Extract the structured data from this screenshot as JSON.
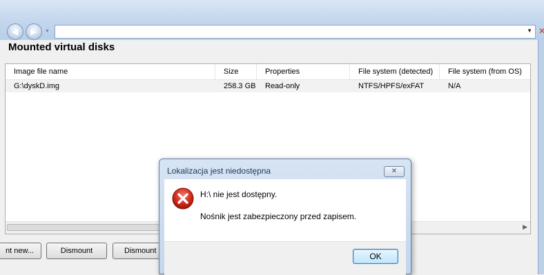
{
  "colors": {
    "accent": "#3c7fb1",
    "error": "#c0392b",
    "row_bg": "#f2f2f2"
  },
  "icons": {
    "back": "back-arrow-icon",
    "forward": "forward-arrow-icon",
    "error": "error-icon",
    "close": "close-icon",
    "dropdown": "chevron-down-icon"
  },
  "browser": {
    "address_value": ""
  },
  "app": {
    "heading": "Mounted virtual disks",
    "columns": [
      "Image file name",
      "Size",
      "Properties",
      "File system (detected)",
      "File system (from OS)"
    ],
    "rows": [
      {
        "image": "G:\\dyskD.img",
        "size": "258.3 GB",
        "properties": "Read-only",
        "fs_detected": "NTFS/HPFS/exFAT",
        "fs_os": "N/A"
      }
    ],
    "buttons": {
      "mount_new": "nt new...",
      "dismount": "Dismount",
      "dismount_all": "Dismount a"
    }
  },
  "dialog": {
    "title": "Lokalizacja jest niedostępna",
    "message_main": "H:\\ nie jest dostępny.",
    "message_detail": "Nośnik jest zabezpieczony przed zapisem.",
    "ok_label": "OK"
  }
}
